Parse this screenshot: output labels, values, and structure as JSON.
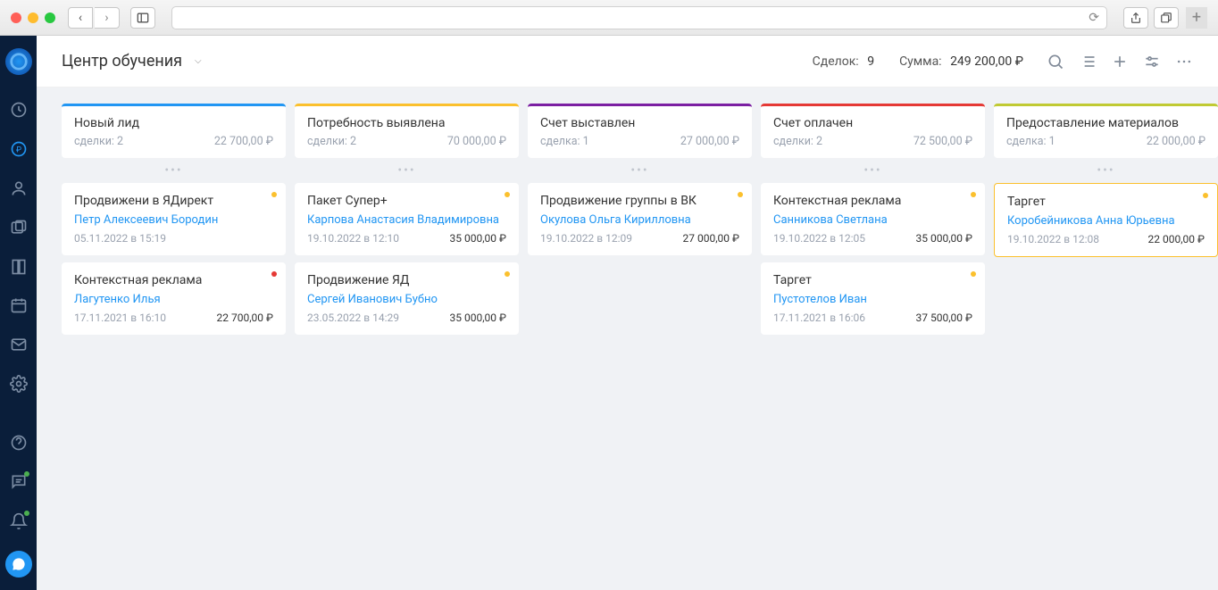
{
  "header": {
    "title": "Центр обучения",
    "deals_label": "Сделок:",
    "deals_count": "9",
    "sum_label": "Сумма:",
    "sum_value": "249 200,00 ₽"
  },
  "columns": [
    {
      "title": "Новый лид",
      "count_label": "сделки: 2",
      "amount": "22 700,00 ₽",
      "cards": [
        {
          "title": "Продвижени в ЯДирект",
          "person": "Петр Алексеевич Бородин",
          "date": "05.11.2022 в 15:19",
          "amount": "",
          "dot": "yellow"
        },
        {
          "title": "Контекстная реклама",
          "person": "Лагутенко Илья",
          "date": "17.11.2021 в 16:10",
          "amount": "22 700,00 ₽",
          "dot": "red"
        }
      ]
    },
    {
      "title": "Потребность выявлена",
      "count_label": "сделки: 2",
      "amount": "70 000,00 ₽",
      "cards": [
        {
          "title": "Пакет Супер+",
          "person": "Карпова Анастасия Владимировна",
          "date": "19.10.2022 в 12:10",
          "amount": "35 000,00 ₽",
          "dot": "yellow"
        },
        {
          "title": "Продвижение ЯД",
          "person": "Сергей Иванович Бубно",
          "date": "23.05.2022 в 14:29",
          "amount": "35 000,00 ₽",
          "dot": "yellow"
        }
      ]
    },
    {
      "title": "Счет выставлен",
      "count_label": "сделка: 1",
      "amount": "27 000,00 ₽",
      "cards": [
        {
          "title": "Продвижение группы в ВК",
          "person": "Окулова Ольга Кирилловна",
          "date": "19.10.2022 в 12:09",
          "amount": "27 000,00 ₽",
          "dot": "yellow"
        }
      ]
    },
    {
      "title": "Счет оплачен",
      "count_label": "сделки: 2",
      "amount": "72 500,00 ₽",
      "cards": [
        {
          "title": "Контекстная реклама",
          "person": "Санникова Светлана",
          "date": "19.10.2022 в 12:05",
          "amount": "35 000,00 ₽",
          "dot": "yellow"
        },
        {
          "title": "Таргет",
          "person": "Пустотелов Иван",
          "date": "17.11.2021 в 16:06",
          "amount": "37 500,00 ₽",
          "dot": "yellow"
        }
      ]
    },
    {
      "title": "Предоставление материалов",
      "count_label": "сделка: 1",
      "amount": "22 000,00 ₽",
      "cards": [
        {
          "title": "Таргет",
          "person": "Коробейникова Анна Юрьевна",
          "date": "19.10.2022 в 12:08",
          "amount": "22 000,00 ₽",
          "dot": "yellow",
          "highlight": true
        }
      ]
    }
  ]
}
